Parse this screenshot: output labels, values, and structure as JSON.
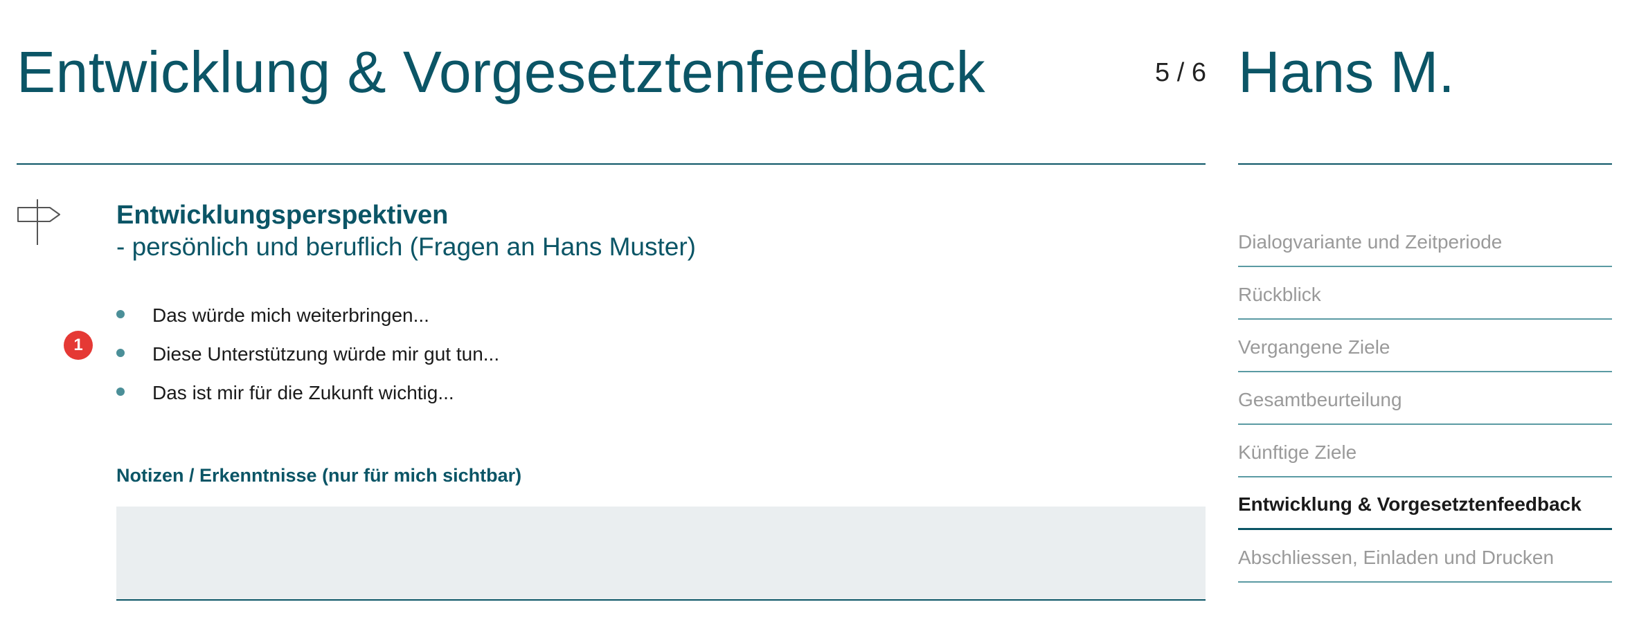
{
  "header": {
    "title": "Entwicklung & Vorgesetztenfeedback",
    "counter": "5 / 6",
    "person_name": "Hans M."
  },
  "section": {
    "icon": "signpost-icon",
    "heading": "Entwicklungsperspektiven",
    "subheading": "- persönlich und beruflich (Fragen an Hans Muster)",
    "badge": "1",
    "bullets": [
      "Das würde mich weiterbringen...",
      "Diese Unterstützung würde mir gut tun...",
      "Das ist mir für die Zukunft wichtig..."
    ]
  },
  "notes": {
    "label": "Notizen / Erkenntnisse (nur für mich sichtbar)",
    "value": ""
  },
  "side_nav": {
    "items": [
      {
        "label": "Dialogvariante und Zeitperiode",
        "active": false
      },
      {
        "label": "Rückblick",
        "active": false
      },
      {
        "label": "Vergangene Ziele",
        "active": false
      },
      {
        "label": "Gesamtbeurteilung",
        "active": false
      },
      {
        "label": "Künftige Ziele",
        "active": false
      },
      {
        "label": "Entwicklung & Vorgesetztenfeedback",
        "active": true
      },
      {
        "label": "Abschliessen, Einladen und Drucken",
        "active": false
      }
    ]
  },
  "colors": {
    "accent": "#0b5566",
    "bullet": "#4b8f98",
    "nav_inactive": "#9a9a9a",
    "notes_bg": "#eaeef0",
    "badge": "#e53935"
  }
}
